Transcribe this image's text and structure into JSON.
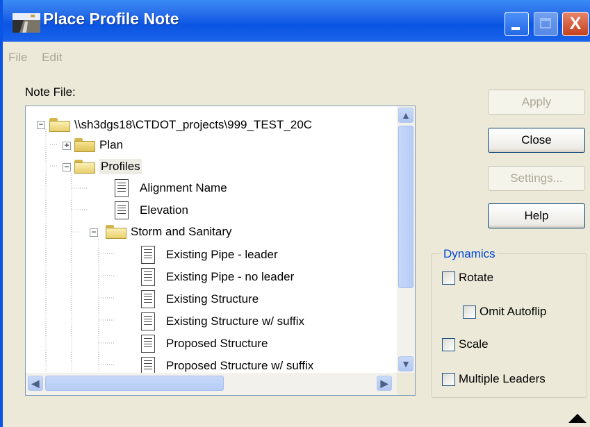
{
  "window": {
    "title": "Place Profile Note",
    "controls": {
      "minimize": "minimize",
      "maximize": "maximize",
      "close": "X"
    }
  },
  "menu": {
    "items": [
      "File",
      "Edit"
    ]
  },
  "note_file": {
    "label": "Note File:",
    "tree": [
      {
        "label": "\\\\sh3dgs18\\CTDOT_projects\\999_TEST_20C",
        "icon": "folder-open-icon",
        "expander": "−"
      },
      {
        "label": "Plan",
        "icon": "folder-icon",
        "expander": "+"
      },
      {
        "label": "Profiles",
        "icon": "folder-open-icon",
        "expander": "−",
        "selected": true
      },
      {
        "label": "Alignment Name",
        "icon": "document-icon"
      },
      {
        "label": "Elevation",
        "icon": "document-icon"
      },
      {
        "label": "Storm and Sanitary",
        "icon": "folder-open-icon",
        "expander": "−"
      },
      {
        "label": "Existing Pipe - leader",
        "icon": "document-icon"
      },
      {
        "label": "Existing Pipe - no leader",
        "icon": "document-icon"
      },
      {
        "label": "Existing Structure",
        "icon": "document-icon"
      },
      {
        "label": "Existing Structure w/ suffix",
        "icon": "document-icon"
      },
      {
        "label": "Proposed Structure",
        "icon": "document-icon"
      },
      {
        "label": "Proposed Structure w/ suffix",
        "icon": "document-icon"
      }
    ]
  },
  "buttons": {
    "apply": "Apply",
    "close": "Close",
    "settings": "Settings...",
    "help": "Help"
  },
  "dynamics": {
    "legend": "Dynamics",
    "rotate": "Rotate",
    "omit_autoflip": "Omit Autoflip",
    "scale": "Scale",
    "multiple_leaders": "Multiple Leaders"
  },
  "colors": {
    "title_bar": "#0a55e3",
    "dialog_bg": "#ece9d8",
    "group_legend": "#0046d5"
  }
}
